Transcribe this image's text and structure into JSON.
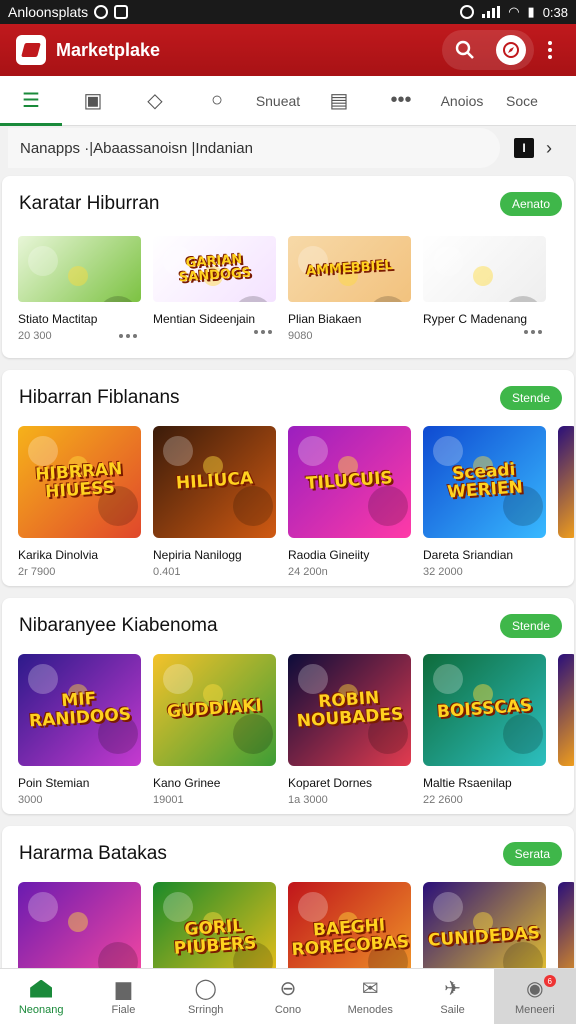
{
  "status_bar": {
    "app_label": "Anloonsplats",
    "time": "0:38"
  },
  "header": {
    "title": "Marketplake",
    "search_icon": "search-icon",
    "compass_icon": "compass-icon"
  },
  "tabs": [
    {
      "kind": "icon",
      "icon": "list-icon",
      "glyph": "☰",
      "active": true
    },
    {
      "kind": "icon",
      "icon": "screen-icon",
      "glyph": "▣"
    },
    {
      "kind": "icon",
      "icon": "shape-icon",
      "glyph": "◇"
    },
    {
      "kind": "icon",
      "icon": "search-icon",
      "glyph": "○"
    },
    {
      "kind": "text",
      "label": "Snueat"
    },
    {
      "kind": "icon",
      "icon": "image-icon",
      "glyph": "▤"
    },
    {
      "kind": "icon",
      "icon": "more-icon",
      "glyph": "•••"
    },
    {
      "kind": "text",
      "label": "Anoios"
    },
    {
      "kind": "text",
      "label": "Soce"
    }
  ],
  "breadcrumb": {
    "text": "Nanapps  ·|Abaassanoisn |Indanian",
    "tool_a": "I",
    "tool_b": "›"
  },
  "sections": [
    {
      "title": "Karatar Hiburran",
      "button": "Aenato",
      "cards": [
        {
          "name": "Stiato Mactitap",
          "meta": "20 300",
          "thumb_text": "",
          "bg": [
            "#e8f6d8",
            "#7cc242"
          ]
        },
        {
          "name": "Mentian Sideenjain",
          "meta": "",
          "thumb_text": "GARIAN SANDOGS",
          "bg": [
            "#ffffff",
            "#f4e2ff"
          ]
        },
        {
          "name": "Plian Biakaen",
          "meta": "9080",
          "thumb_text": "AMMEBBIEL",
          "bg": [
            "#f7d9a8",
            "#f2c27e"
          ]
        },
        {
          "name": "Ryper C Madenang",
          "meta": "",
          "thumb_text": "",
          "bg": [
            "#ffffff",
            "#eeeeee"
          ]
        }
      ]
    },
    {
      "title": "Hibarran Fiblanans",
      "button": "Stende",
      "cards": [
        {
          "name": "Karika Dinolvia",
          "meta": "2r 7900",
          "thumb_text": "HIBRRAN HIUESS",
          "bg": [
            "#f6b21a",
            "#e0472b"
          ]
        },
        {
          "name": "Nepiria Nanilogg",
          "meta": "0.401",
          "thumb_text": "HILIUCA",
          "bg": [
            "#3a1b0a",
            "#d05a12"
          ]
        },
        {
          "name": "Raodia Gineiity",
          "meta": "24 200n",
          "thumb_text": "TILUCUIS",
          "bg": [
            "#9b1fbf",
            "#ff3aa7"
          ]
        },
        {
          "name": "Dareta Sriandian",
          "meta": "32 2000",
          "thumb_text": "Sceadi WERIEN",
          "bg": [
            "#0f4ad1",
            "#38b9ff"
          ]
        }
      ]
    },
    {
      "title": "Nibaranyee Kiabenoma",
      "button": "Stende",
      "cards": [
        {
          "name": "Poin Stemian",
          "meta": "3000",
          "thumb_text": "MIF RANIDOOS",
          "bg": [
            "#2c1a8a",
            "#c63ad0"
          ]
        },
        {
          "name": "Kano Grinee",
          "meta": "19001",
          "thumb_text": "GUDDIAKI",
          "bg": [
            "#f4c22a",
            "#3d9d35"
          ]
        },
        {
          "name": "Koparet Dornes",
          "meta": "1a 3000",
          "thumb_text": "ROBIN NOUBADES",
          "bg": [
            "#0c0c3a",
            "#e23b4f"
          ]
        },
        {
          "name": "Maltie Rsaenilap",
          "meta": "22 2600",
          "thumb_text": "BOISSCAS",
          "bg": [
            "#0e6b3a",
            "#2cbfbf"
          ]
        }
      ]
    },
    {
      "title": "Hararma Batakas",
      "button": "Serata",
      "cards": [
        {
          "name": "",
          "meta": "",
          "thumb_text": "",
          "bg": [
            "#6a1bb0",
            "#ff4aa0"
          ]
        },
        {
          "name": "",
          "meta": "",
          "thumb_text": "GORIL PIUBERS",
          "bg": [
            "#1a8a2a",
            "#f6c21a"
          ]
        },
        {
          "name": "",
          "meta": "",
          "thumb_text": "BAEGHI RORECOBAS",
          "bg": [
            "#c0151b",
            "#f4a02a"
          ]
        },
        {
          "name": "",
          "meta": "",
          "thumb_text": "CUNIDEDAS",
          "bg": [
            "#2a0f7a",
            "#f5d12a"
          ]
        }
      ]
    }
  ],
  "bottom_nav": [
    {
      "label": "Neonang",
      "icon": "home-icon",
      "glyph": "",
      "active": true
    },
    {
      "label": "Fiale",
      "icon": "chat-icon",
      "glyph": "▆"
    },
    {
      "label": "Srringh",
      "icon": "location-icon",
      "glyph": "◯"
    },
    {
      "label": "Cono",
      "icon": "circle-icon",
      "glyph": "⊖"
    },
    {
      "label": "Menodes",
      "icon": "mail-icon",
      "glyph": "✉"
    },
    {
      "label": "Saile",
      "icon": "plane-icon",
      "glyph": "✈"
    },
    {
      "label": "Meneeri",
      "icon": "profile-icon",
      "glyph": "◉",
      "badge": "6"
    }
  ]
}
